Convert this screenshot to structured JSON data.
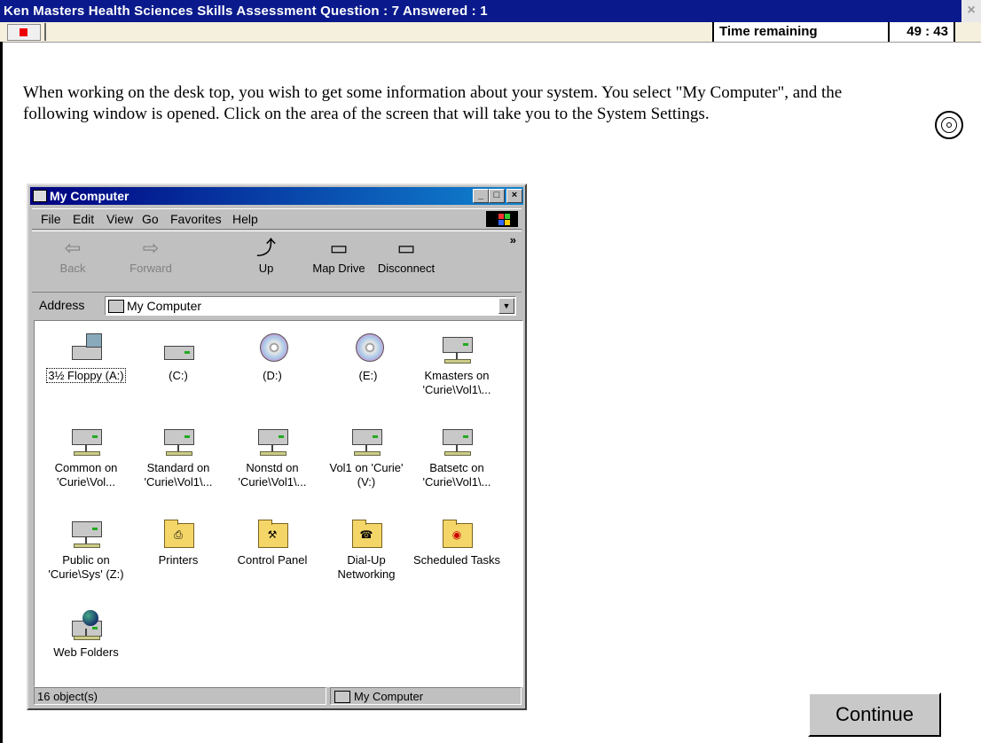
{
  "app": {
    "title": "Ken Masters  Health Sciences Skills Assessment  Question : 7  Answered : 1",
    "close_label": "×"
  },
  "timer": {
    "label": "Time remaining",
    "value": "49 : 43"
  },
  "question": {
    "text": "When working on the desk top, you wish to get some information about your system.  You select \"My Computer\", and the following window is opened.  Click on the area of the screen that will take you to the System Settings."
  },
  "window": {
    "title": "My Computer",
    "min_label": "_",
    "max_label": "□",
    "close_label": "×",
    "menu": [
      "File",
      "Edit",
      "View",
      "Go",
      "Favorites",
      "Help"
    ],
    "toolbar": [
      {
        "label": "Back",
        "icon": "back-arrow-icon",
        "enabled": false
      },
      {
        "label": "Forward",
        "icon": "forward-arrow-icon",
        "enabled": false
      },
      {
        "label": "Up",
        "icon": "up-folder-icon",
        "enabled": true
      },
      {
        "label": "Map Drive",
        "icon": "map-drive-icon",
        "enabled": true
      },
      {
        "label": "Disconnect",
        "icon": "disconnect-icon",
        "enabled": true
      }
    ],
    "toolbar_more": "»",
    "address_label": "Address",
    "address_value": "My Computer",
    "items": [
      {
        "label": "3½ Floppy (A:)",
        "type": "floppy"
      },
      {
        "label": "(C:)",
        "type": "drive"
      },
      {
        "label": "(D:)",
        "type": "cd"
      },
      {
        "label": "(E:)",
        "type": "cd"
      },
      {
        "label": "Kmasters on 'Curie\\Vol1\\...",
        "type": "net"
      },
      {
        "label": "Common on 'Curie\\Vol...",
        "type": "net"
      },
      {
        "label": "Standard on 'Curie\\Vol1\\...",
        "type": "net"
      },
      {
        "label": "Nonstd on 'Curie\\Vol1\\...",
        "type": "net"
      },
      {
        "label": "Vol1 on 'Curie' (V:)",
        "type": "net"
      },
      {
        "label": "Batsetc on 'Curie\\Vol1\\...",
        "type": "net"
      },
      {
        "label": "Public on 'Curie\\Sys' (Z:)",
        "type": "net"
      },
      {
        "label": "Printers",
        "type": "folder-printers"
      },
      {
        "label": "Control Panel",
        "type": "folder-control"
      },
      {
        "label": "Dial-Up Networking",
        "type": "folder-dialup"
      },
      {
        "label": "Scheduled Tasks",
        "type": "folder-tasks"
      },
      {
        "label": "Web Folders",
        "type": "webfolders"
      }
    ],
    "status_left": "16 object(s)",
    "status_right": "My Computer"
  },
  "buttons": {
    "continue": "Continue"
  },
  "colors": {
    "app_titlebar": "#0a1a8c",
    "window_title_start": "#000080",
    "window_title_end": "#1084d0",
    "stop_icon": "#e00000"
  }
}
